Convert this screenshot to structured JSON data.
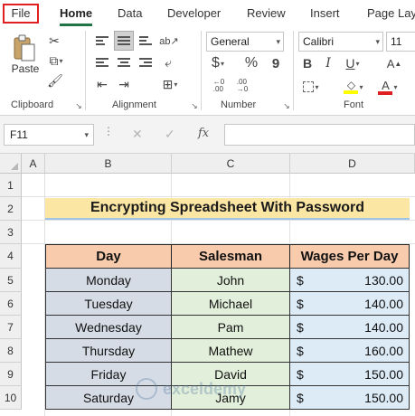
{
  "tabs": [
    {
      "label": "File"
    },
    {
      "label": "Home"
    },
    {
      "label": "Data"
    },
    {
      "label": "Developer"
    },
    {
      "label": "Review"
    },
    {
      "label": "Insert"
    },
    {
      "label": "Page Lay"
    }
  ],
  "ribbon": {
    "clipboard": {
      "paste_label": "Paste",
      "group_label": "Clipboard"
    },
    "alignment": {
      "group_label": "Alignment"
    },
    "number": {
      "format_value": "General",
      "group_label": "Number",
      "currency_symbol": "$",
      "percent_symbol": "%",
      "comma_symbol": "9"
    },
    "font": {
      "family_value": "Calibri",
      "size_value": "11",
      "bold_label": "B",
      "italic_label": "I",
      "underline_label": "U",
      "font_color_label": "A",
      "group_label": "Font"
    },
    "colors": {
      "highlight": "#ffff00",
      "font_color": "#e02020",
      "accent": "#217346"
    }
  },
  "formula_bar": {
    "name_box": "F11",
    "cancel_icon": "✕",
    "enter_icon": "✓",
    "fx_label": "fx",
    "formula": ""
  },
  "columns": [
    "A",
    "B",
    "C",
    "D"
  ],
  "rows": [
    "1",
    "2",
    "3",
    "4",
    "5",
    "6",
    "7",
    "8",
    "9",
    "10"
  ],
  "sheet": {
    "title": "Encrypting Spreadsheet With Password",
    "headers": [
      "Day",
      "Salesman",
      "Wages Per Day"
    ],
    "records": [
      {
        "day": "Monday",
        "salesman": "John",
        "currency": "$",
        "wage": "130.00"
      },
      {
        "day": "Tuesday",
        "salesman": "Michael",
        "currency": "$",
        "wage": "140.00"
      },
      {
        "day": "Wednesday",
        "salesman": "Pam",
        "currency": "$",
        "wage": "140.00"
      },
      {
        "day": "Thursday",
        "salesman": "Mathew",
        "currency": "$",
        "wage": "160.00"
      },
      {
        "day": "Friday",
        "salesman": "David",
        "currency": "$",
        "wage": "150.00"
      },
      {
        "day": "Saturday",
        "salesman": "Jamy",
        "currency": "$",
        "wage": "150.00"
      }
    ]
  },
  "watermark": {
    "text": "exceldemy"
  }
}
